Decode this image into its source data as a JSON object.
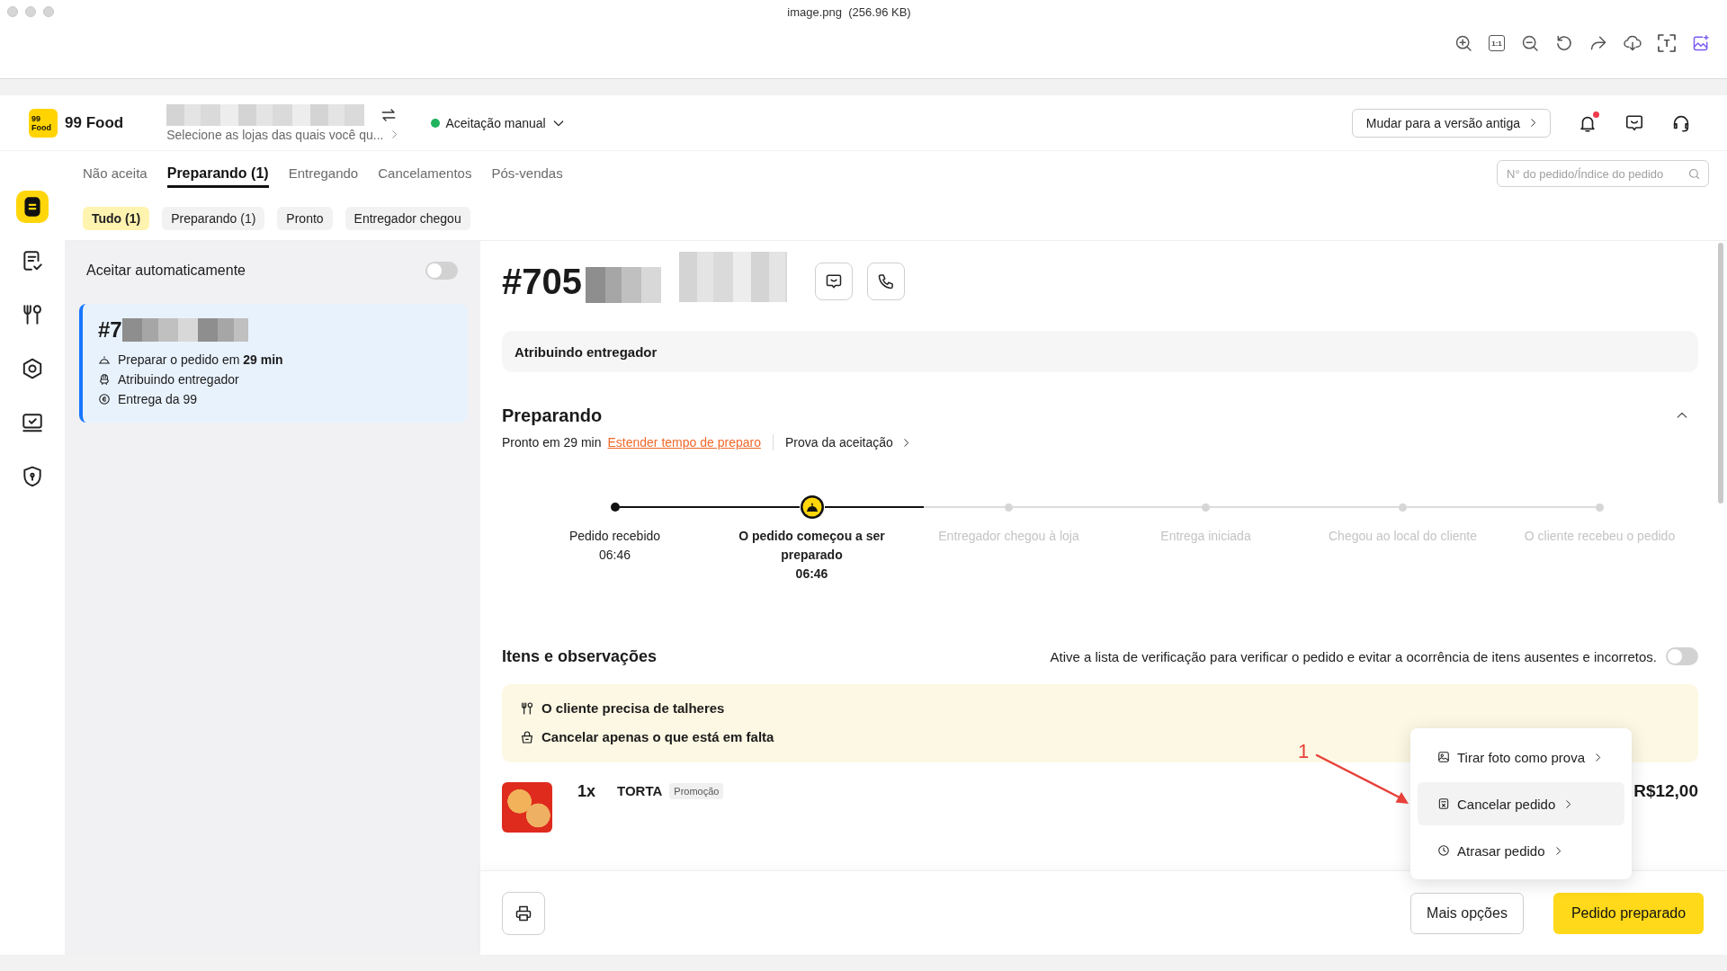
{
  "viewer": {
    "title": "image.png  (256.96 KB)",
    "toolbar": [
      {
        "kind": "zoom-in"
      },
      {
        "kind": "actual-size",
        "label": "1:1"
      },
      {
        "kind": "zoom-out"
      },
      {
        "kind": "rotate"
      },
      {
        "kind": "share"
      },
      {
        "kind": "download"
      },
      {
        "kind": "text-recognition",
        "label": "T"
      },
      {
        "kind": "image-edit"
      }
    ]
  },
  "header": {
    "logo": [
      "99",
      "Food"
    ],
    "brand": "99 Food",
    "store_hint": "Selecione as lojas das quais você qu...",
    "acceptance": {
      "label": "Aceitação manual",
      "active": true
    },
    "old_version_button": "Mudar para a versão antiga",
    "notifications": {
      "unread": true
    }
  },
  "sidebar": {
    "items": [
      {
        "kind": "orders",
        "selected": true
      },
      {
        "kind": "order-history",
        "selected": false
      },
      {
        "kind": "menu",
        "selected": false
      },
      {
        "kind": "settings",
        "selected": false
      },
      {
        "kind": "monitor",
        "selected": false
      },
      {
        "kind": "security",
        "selected": false
      }
    ]
  },
  "tabs": [
    {
      "label": "Não aceita",
      "selected": false
    },
    {
      "label": "Preparando (1)",
      "selected": true
    },
    {
      "label": "Entregando",
      "selected": false
    },
    {
      "label": "Cancelamentos",
      "selected": false
    },
    {
      "label": "Pós-vendas",
      "selected": false
    }
  ],
  "filters": [
    {
      "label": "Tudo (1)",
      "selected": true
    },
    {
      "label": "Preparando (1)",
      "selected": false
    },
    {
      "label": "Pronto",
      "selected": false
    },
    {
      "label": "Entregador chegou",
      "selected": false
    }
  ],
  "search": {
    "placeholder": "N° do pedido/Índice do pedido"
  },
  "order_list": {
    "auto_accept": {
      "label": "Aceitar automaticamente",
      "on": false
    },
    "cards": [
      {
        "number": "#7",
        "selected": true,
        "lines": [
          {
            "kind": "prepare",
            "text": "Preparar o pedido em **29 min**"
          },
          {
            "kind": "courier",
            "text": "Atribuindo entregador"
          },
          {
            "kind": "delivery",
            "text": "Entrega da 99"
          }
        ]
      }
    ]
  },
  "order": {
    "number": "#705",
    "status_banner": "Atribuindo entregador",
    "stage": {
      "title": "Preparando",
      "expanded": true,
      "ready": "Pronto em 29 min",
      "extend_link": "Estender tempo de preparo",
      "proof_link": "Prova da aceitação"
    },
    "timeline": [
      {
        "label": "Pedido recebido",
        "time": "06:46",
        "reached": true,
        "current": false
      },
      {
        "label": "O pedido começou a ser preparado",
        "time": "06:46",
        "reached": true,
        "current": true
      },
      {
        "label": "Entregador chegou à loja",
        "reached": false,
        "current": false
      },
      {
        "label": "Entrega iniciada",
        "reached": false,
        "current": false
      },
      {
        "label": "Chegou ao local do cliente",
        "reached": false,
        "current": false
      },
      {
        "label": "O cliente recebeu o pedido",
        "reached": false,
        "current": false
      }
    ],
    "items_section": {
      "title": "Itens e observações",
      "checklist": {
        "text": "Ative a lista de verificação para verificar o pedido e evitar a ocorrência de itens ausentes e incorretos.",
        "on": false
      },
      "notes": [
        {
          "kind": "cutlery",
          "text": "O cliente precisa de talheres"
        },
        {
          "kind": "bag",
          "text": "Cancelar apenas o que está em falta"
        }
      ],
      "items": [
        {
          "quantity": "1x",
          "name": "TORTA",
          "tag": "Promoção",
          "price": "R$12,00"
        }
      ]
    },
    "more_menu": {
      "items": [
        {
          "kind": "photo",
          "label": "Tirar foto como prova",
          "selected": false
        },
        {
          "kind": "cancel",
          "label": "Cancelar pedido",
          "selected": true
        },
        {
          "kind": "delay",
          "label": "Atrasar pedido",
          "selected": false
        }
      ]
    },
    "footer": {
      "more_button": "Mais opções",
      "primary_button": "Pedido preparado"
    }
  },
  "annotation": {
    "label": "1"
  }
}
